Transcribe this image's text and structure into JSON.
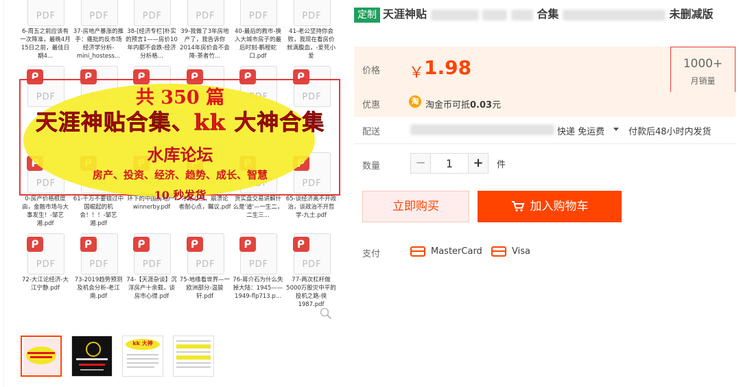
{
  "gallery": {
    "row0": [
      "6-周五之前应该有一次降准，最晚4月15日之前，最佳日期4...",
      "37-房地产暴涨的推手：痛批的反市场经济学分析-mini_hostess...",
      "38-[经济专栏]朴实的预言1——房价10年内都不会跌-经济分析格...",
      "39-我做了3年房地产了，我告诉你2014年房价会不会降-茶者竹...",
      "40-最后的救市-换入大城市房子的最后时刻-鹏程蛇口.pdf",
      "41-老公坚持你会败，我现在看房价就满腹血，-爱死小爱"
    ],
    "row2": [
      "0-房产价格根度由，金融市场与大事发生！-邹艺湘.pdf",
      "61-千万不要错过中国崛起的机会！！！-邹艺湘.pdf",
      "环下的中国房地产-winnerby.pdf",
      "才是心点，崩溃论者耐心点，瞩议.pdf",
      "货实盘交易讲解什么是'道'—一生二，二生三...",
      "65-谈经济离不开政治，谈政治不开哲学-九士.pdf"
    ],
    "row3": [
      "72-大江论经济-大江宁静.pdf",
      "73-2019趋势预测及机会分析-老江南.pdf",
      "74-【天涯杂谈】沉浮房产十余载，谈房市心得.pdf",
      "75-地缘看世界—一欧洲部分-温骏轩.pdf",
      "76-蒋介石为什么失掉大陆：1945——1949-flp713.p...",
      "77-两次杠杆做5000万股灾中平的投机之路-侠1987.pdf"
    ],
    "pdf_word": "PDF",
    "banner": {
      "line1": "共 350 篇",
      "line2": "天涯神贴合集、kk 大神合集",
      "line3": "水库论坛",
      "line4": "房产、投资、经济、趋势、成长、智慧",
      "line5": "10 秒发货"
    },
    "thumb3_text": "kk 大神"
  },
  "product": {
    "tag": "定制",
    "title_start": "天涯神贴",
    "title_mid": "合集",
    "title_end": "未删减版"
  },
  "price": {
    "label": "价格",
    "symbol": "￥",
    "value": "1.98"
  },
  "sales": {
    "count": "1000+",
    "label": "月销量"
  },
  "promo": {
    "label": "优惠",
    "coin_text": "淘",
    "text_prefix": "淘金币可抵",
    "amount": "0.03",
    "unit": "元"
  },
  "shipping": {
    "label": "配送",
    "mode": "快递 免运费",
    "time": "付款后48小时内发货"
  },
  "quantity": {
    "label": "数量",
    "value": "1",
    "unit": "件",
    "minus": "−",
    "plus": "+"
  },
  "actions": {
    "buy_now": "立即购买",
    "add_to_cart": "加入购物车"
  },
  "payment": {
    "label": "支付",
    "methods": [
      "MasterCard",
      "Visa"
    ]
  },
  "colors": {
    "accent": "#ff4400",
    "tag_green": "#1e9f5e",
    "price_bg": "#fff2e8"
  }
}
